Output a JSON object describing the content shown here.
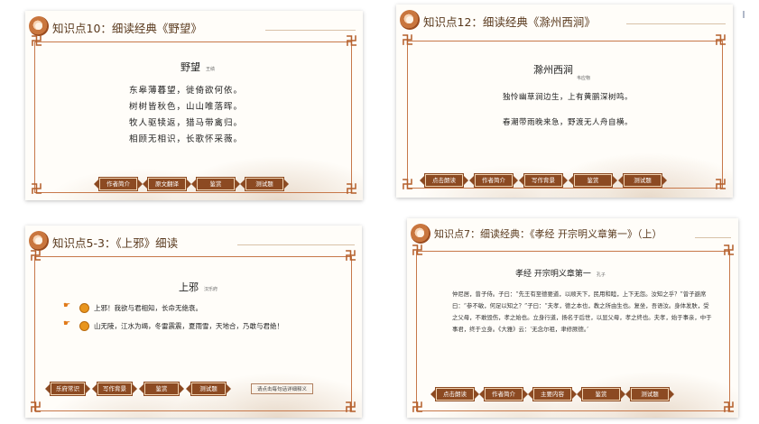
{
  "slides": [
    {
      "title": "知识点10：细读经典《野望》",
      "poem_title": "野望",
      "poem_author": "王绩",
      "lines": [
        "东皋薄暮望，徙倚欲何依。",
        "树树皆秋色，山山唯落晖。",
        "牧人驱犊返，猎马带禽归。",
        "相顾无相识，长歌怀采薇。"
      ],
      "buttons": [
        "作者简介",
        "原文翻译",
        "鉴赏",
        "测试题"
      ]
    },
    {
      "title": "知识点12：细读经典《滁州西涧》",
      "poem_title": "滁州西涧",
      "poem_author": "韦应物",
      "lines": [
        "独怜幽草涧边生，上有黄鹂深树鸣。",
        "春潮带雨晚来急，野渡无人舟自横。"
      ],
      "buttons": [
        "点击朗读",
        "作者简介",
        "写作背景",
        "鉴赏",
        "测试题"
      ]
    },
    {
      "title": "知识点5-3：《上邪》细读",
      "poem_title": "上邪",
      "poem_author": "汉乐府",
      "lines": [
        "上邪！我欲与君相知，长命无绝衰。",
        "山无陵，江水为竭，冬雷震震，夏雨雪，天地合，乃敢与君绝！"
      ],
      "buttons": [
        "乐府常识",
        "写作背景",
        "鉴赏",
        "测试题"
      ],
      "note": "请点击每句话详细释义"
    },
    {
      "title": "知识点7：细读经典：《孝经 开宗明义章第一》（上）",
      "poem_title": "孝经 开宗明义章第一",
      "poem_author": "孔子",
      "paragraph": "仲尼居，曾子侍。子曰：“先王有至德要道，以顺天下，民用和睦，上下无怨。汝知之乎？”曾子避席曰：“参不敏，何足以知之？”子曰：“夫孝，德之本也，教之所由生也。复坐，吾语汝。身体发肤，受之父母，不敢毁伤，孝之始也。立身行道，扬名于后世，以显父母，孝之终也。夫孝，始于事亲，中于事君，终于立身。《大雅》云：‘无念尔祖，聿修厥德。’",
      "buttons": [
        "点击朗读",
        "作者简介",
        "主要内容",
        "鉴赏",
        "测试题"
      ]
    }
  ],
  "icons": {
    "corner": "swastika-knot-ornament-icon",
    "logo": "orange-flower-logo-icon",
    "hand": "pointing-hand-icon",
    "flower": "flower-bullet-icon"
  },
  "colors": {
    "accent": "#8c4a22",
    "frame": "#c7784a",
    "title": "#5a3a1e"
  }
}
